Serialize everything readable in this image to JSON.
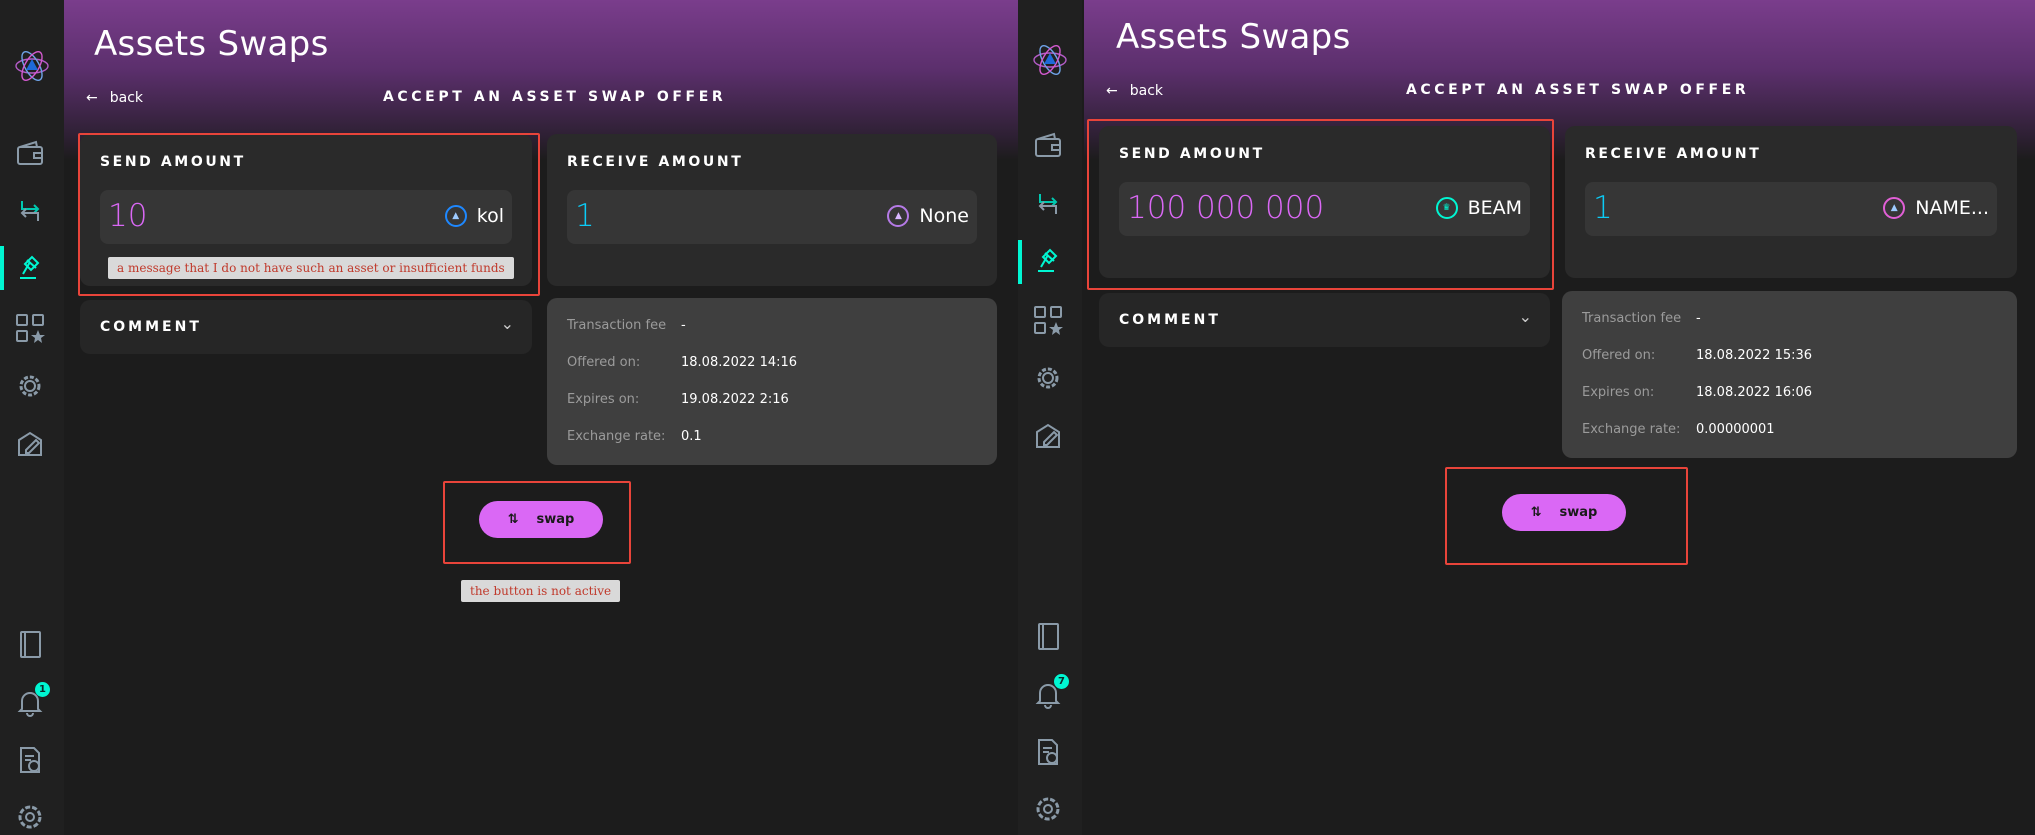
{
  "app": {
    "colors": {
      "accent": "#00f6d2",
      "send": "#da68f5",
      "receive": "#0bccf7",
      "annotation": "#e8443a"
    },
    "nav_icons": [
      "logo-icon",
      "wallet-icon",
      "transactions-icon",
      "asset-swap-icon",
      "dapps-icon",
      "settings-gear-icon",
      "dapp-editor-icon",
      "address-book-icon",
      "notifications-bell-icon",
      "help-docs-icon",
      "settings-icon"
    ]
  },
  "panels": [
    {
      "title": "Assets Swaps",
      "back_label": "back",
      "section_title": "ACCEPT AN ASSET SWAP OFFER",
      "notification_count": "1",
      "send": {
        "label": "SEND AMOUNT",
        "amount": "10",
        "asset": "kol"
      },
      "receive": {
        "label": "RECEIVE AMOUNT",
        "amount": "1",
        "asset": "None"
      },
      "comment_label": "COMMENT",
      "info": {
        "fee_label": "Transaction fee",
        "fee_value": "-",
        "offered_label": "Offered on:",
        "offered_value": "18.08.2022 14:16",
        "expires_label": "Expires on:",
        "expires_value": "19.08.2022 2:16",
        "rate_label": "Exchange rate:",
        "rate_value": "0.1"
      },
      "swap_label": "swap",
      "notes": {
        "send": "a message that I do not have such an asset or insufficient funds",
        "button": "the button is not active"
      }
    },
    {
      "title": "Assets Swaps",
      "back_label": "back",
      "section_title": "ACCEPT AN ASSET SWAP OFFER",
      "notification_count": "7",
      "send": {
        "label": "SEND AMOUNT",
        "amount": "100 000 000",
        "asset": "BEAM"
      },
      "receive": {
        "label": "RECEIVE AMOUNT",
        "amount": "1",
        "asset": "NAME..."
      },
      "comment_label": "COMMENT",
      "info": {
        "fee_label": "Transaction fee",
        "fee_value": "-",
        "offered_label": "Offered on:",
        "offered_value": "18.08.2022 15:36",
        "expires_label": "Expires on:",
        "expires_value": "18.08.2022 16:06",
        "rate_label": "Exchange rate:",
        "rate_value": "0.00000001"
      },
      "swap_label": "swap"
    }
  ]
}
